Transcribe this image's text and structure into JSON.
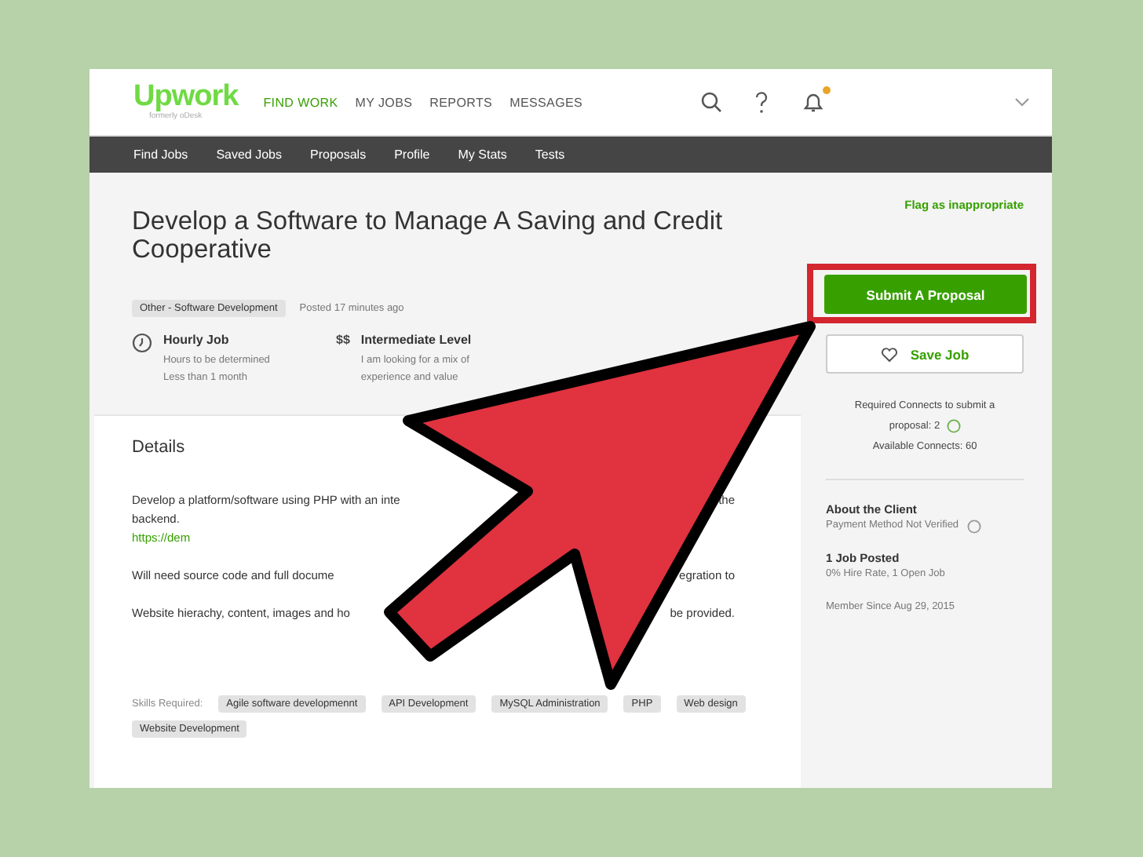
{
  "header": {
    "logo": "Upwork",
    "logo_sub": "formerly oDesk",
    "nav": [
      {
        "label": "FIND WORK",
        "selected": true
      },
      {
        "label": "MY JOBS",
        "selected": false
      },
      {
        "label": "REPORTS",
        "selected": false
      },
      {
        "label": "MESSAGES",
        "selected": false
      }
    ],
    "notification_dot": true
  },
  "subnav": [
    {
      "label": "Find Jobs"
    },
    {
      "label": "Saved Jobs"
    },
    {
      "label": "Proposals"
    },
    {
      "label": "Profile"
    },
    {
      "label": "My Stats"
    },
    {
      "label": "Tests"
    }
  ],
  "job": {
    "title": "Develop a Software to Manage A Saving and Credit Cooperative",
    "category": "Other - Software Development",
    "posted": "Posted 17 minutes ago",
    "facts": [
      {
        "kind": "clock",
        "title": "Hourly Job",
        "lines": [
          "Hours to be determined",
          "Less than 1 month"
        ]
      },
      {
        "kind": "money",
        "symbol": "$$",
        "title": "Intermediate Level",
        "lines": [
          "I am looking for a mix of",
          "experience and value"
        ]
      }
    ],
    "details_heading": "Details",
    "description": [
      {
        "kind": "text",
        "left": "Develop a platform/software using PHP with an inte",
        "right": "the"
      },
      {
        "kind": "text",
        "left": "backend."
      },
      {
        "kind": "link",
        "left": "https://dem"
      },
      {
        "kind": "gap"
      },
      {
        "kind": "text",
        "left": "Will need source code and full docume",
        "right": "egration to"
      },
      {
        "kind": "gap"
      },
      {
        "kind": "text",
        "left": "Website hierachy, content, images and ho",
        "right": "be provided."
      }
    ],
    "skills_label": "Skills Required:",
    "skills": [
      "Agile software developmennt",
      "API Development",
      "MySQL Administration",
      "PHP",
      "Web design",
      "Website Development"
    ]
  },
  "sidebar": {
    "flag": "Flag as inappropriate",
    "submit": "Submit A Proposal",
    "highlighted": true,
    "save": "Save Job",
    "connects": [
      "Required Connects to submit a",
      "proposal: 2",
      "Available Connects: 60"
    ],
    "client_heading": "About the Client",
    "payment": "Payment Method Not Verified",
    "jobs_posted": "1 Job Posted",
    "hire_rate": "0% Hire Rate, 1 Open Job",
    "member_since": "Member Since Aug 29, 2015"
  }
}
